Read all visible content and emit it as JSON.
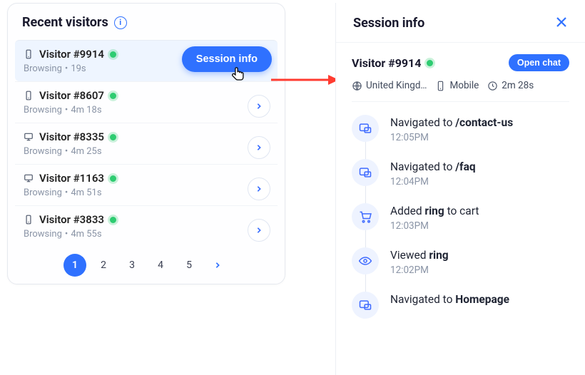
{
  "left": {
    "title": "Recent visitors",
    "visitors": [
      {
        "device": "mobile",
        "name": "Visitor #9914",
        "status": "Browsing",
        "duration": "19s"
      },
      {
        "device": "mobile",
        "name": "Visitor #8607",
        "status": "Browsing",
        "duration": "4m 18s"
      },
      {
        "device": "desktop",
        "name": "Visitor #8335",
        "status": "Browsing",
        "duration": "4m 25s"
      },
      {
        "device": "desktop",
        "name": "Visitor #1163",
        "status": "Browsing",
        "duration": "4m 51s"
      },
      {
        "device": "mobile",
        "name": "Visitor #3833",
        "status": "Browsing",
        "duration": "4m 55s"
      }
    ],
    "session_info_btn": "Session info",
    "pages": [
      "1",
      "2",
      "3",
      "4",
      "5"
    ]
  },
  "right": {
    "header": "Session info",
    "visitor": "Visitor #9914",
    "open_chat": "Open chat",
    "meta": {
      "country": "United Kingd…",
      "device": "Mobile",
      "duration": "2m 28s"
    },
    "timeline": [
      {
        "icon": "nav",
        "pre": "Navigated to ",
        "bold": "/contact-us",
        "post": "",
        "time": "12:05PM"
      },
      {
        "icon": "nav",
        "pre": "Navigated to ",
        "bold": "/faq",
        "post": "",
        "time": "12:04PM"
      },
      {
        "icon": "cart",
        "pre": "Added ",
        "bold": "ring",
        "post": " to cart",
        "time": "12:03PM"
      },
      {
        "icon": "eye",
        "pre": "Viewed ",
        "bold": "ring",
        "post": "",
        "time": "12:02PM"
      },
      {
        "icon": "nav",
        "pre": "Navigated to ",
        "bold": "Homepage",
        "post": "",
        "time": ""
      }
    ]
  }
}
